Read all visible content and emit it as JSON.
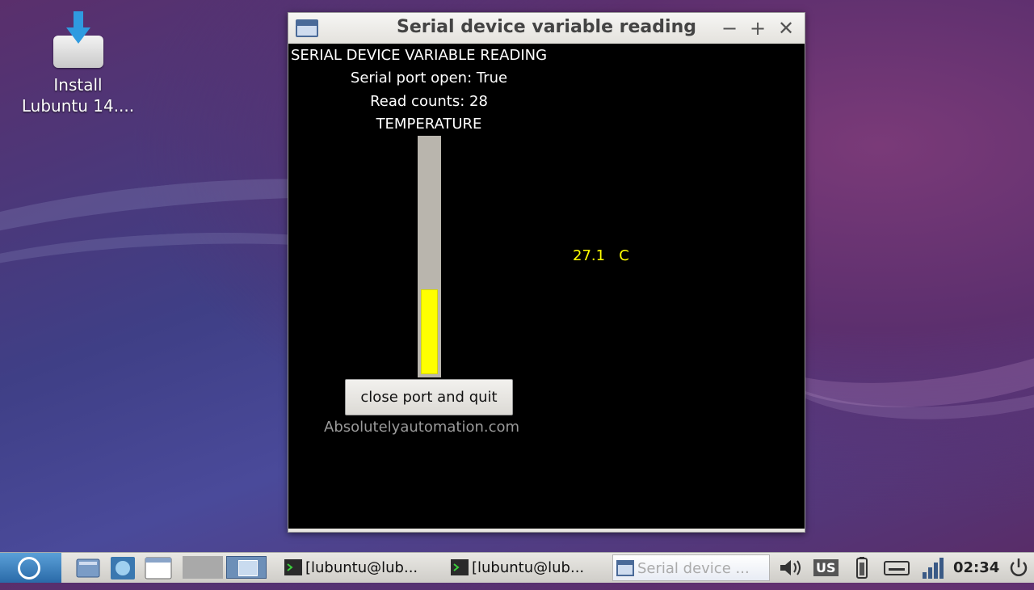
{
  "desktop": {
    "install_icon_label_line1": "Install",
    "install_icon_label_line2": "Lubuntu 14...."
  },
  "window": {
    "title": "Serial device variable reading",
    "controls": {
      "minimize": "−",
      "maximize": "+",
      "close": "✕"
    },
    "heading": "SERIAL DEVICE VARIABLE READING",
    "serial_port_status": "Serial port open: True",
    "read_counts": "Read counts: 28",
    "gauge_label": "TEMPERATURE",
    "gauge_fill_fraction": 0.36,
    "gauge_fill_color": "#ffff00",
    "temperature_value": "27.1",
    "temperature_unit": "C",
    "quit_button": "close port and quit",
    "website": "Absolutelyautomation.com"
  },
  "taskbar": {
    "tasks": [
      {
        "label": "[lubuntu@lub...",
        "icon": "terminal-icon"
      },
      {
        "label": "[lubuntu@lub...",
        "icon": "terminal-icon"
      },
      {
        "label": "Serial device ...",
        "icon": "window-icon",
        "active": true
      }
    ],
    "keyboard_layout": "US",
    "clock": "02:34"
  }
}
